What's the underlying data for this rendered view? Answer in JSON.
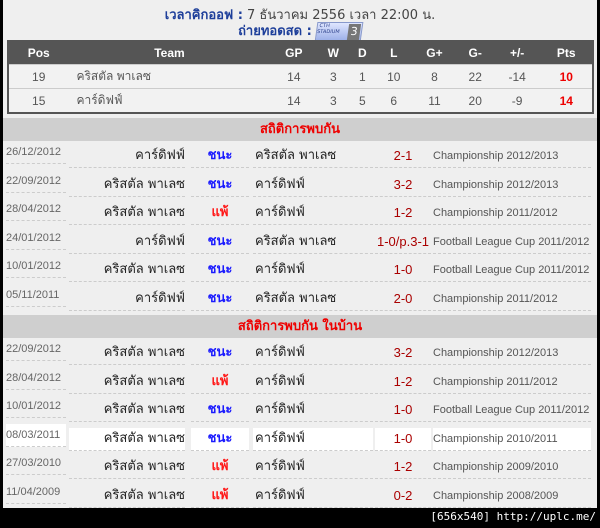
{
  "header": {
    "kickoff_label": "เวลาคิกออฟ :",
    "kickoff_value": "7 ธันวาคม 2556 เวลา 22:00 น.",
    "live_label": "ถ่ายทอดสด :",
    "channel_logo": "CTH STADIUM 3"
  },
  "standings": {
    "columns": [
      "Pos",
      "Team",
      "GP",
      "W",
      "D",
      "L",
      "G+",
      "G-",
      "+/-",
      "Pts"
    ],
    "rows": [
      [
        "19",
        "คริสตัล พาเลซ",
        "14",
        "3",
        "1",
        "10",
        "8",
        "22",
        "-14",
        "10"
      ],
      [
        "15",
        "คาร์ดิฟฟ์",
        "14",
        "3",
        "5",
        "6",
        "11",
        "20",
        "-9",
        "14"
      ]
    ]
  },
  "sections": [
    {
      "title": "สถิติการพบกัน",
      "rows": [
        {
          "date": "26/12/2012",
          "home": "คาร์ดิฟฟ์",
          "result": "ชนะ",
          "away": "คริสตัล พาเลซ",
          "score": "2-1",
          "comp": "Championship 2012/2013"
        },
        {
          "date": "22/09/2012",
          "home": "คริสตัล พาเลซ",
          "result": "ชนะ",
          "away": "คาร์ดิฟฟ์",
          "score": "3-2",
          "comp": "Championship 2012/2013"
        },
        {
          "date": "28/04/2012",
          "home": "คริสตัล พาเลซ",
          "result": "แพ้",
          "away": "คาร์ดิฟฟ์",
          "score": "1-2",
          "comp": "Championship 2011/2012"
        },
        {
          "date": "24/01/2012",
          "home": "คาร์ดิฟฟ์",
          "result": "ชนะ",
          "away": "คริสตัล พาเลซ",
          "score": "1-0/p.3-1",
          "comp": "Football League Cup 2011/2012"
        },
        {
          "date": "10/01/2012",
          "home": "คริสตัล พาเลซ",
          "result": "ชนะ",
          "away": "คาร์ดิฟฟ์",
          "score": "1-0",
          "comp": "Football League Cup 2011/2012"
        },
        {
          "date": "05/11/2011",
          "home": "คาร์ดิฟฟ์",
          "result": "ชนะ",
          "away": "คริสตัล พาเลซ",
          "score": "2-0",
          "comp": "Championship 2011/2012"
        }
      ]
    },
    {
      "title": "สถิติการพบกัน ในบ้าน",
      "rows": [
        {
          "date": "22/09/2012",
          "home": "คริสตัล พาเลซ",
          "result": "ชนะ",
          "away": "คาร์ดิฟฟ์",
          "score": "3-2",
          "comp": "Championship 2012/2013"
        },
        {
          "date": "28/04/2012",
          "home": "คริสตัล พาเลซ",
          "result": "แพ้",
          "away": "คาร์ดิฟฟ์",
          "score": "1-2",
          "comp": "Championship 2011/2012"
        },
        {
          "date": "10/01/2012",
          "home": "คริสตัล พาเลซ",
          "result": "ชนะ",
          "away": "คาร์ดิฟฟ์",
          "score": "1-0",
          "comp": "Football League Cup 2011/2012"
        },
        {
          "date": "08/03/2011",
          "home": "คริสตัล พาเลซ",
          "result": "ชนะ",
          "away": "คาร์ดิฟฟ์",
          "score": "1-0",
          "comp": "Championship 2010/2011"
        },
        {
          "date": "27/03/2010",
          "home": "คริสตัล พาเลซ",
          "result": "แพ้",
          "away": "คาร์ดิฟฟ์",
          "score": "1-2",
          "comp": "Championship 2009/2010"
        },
        {
          "date": "11/04/2009",
          "home": "คริสตัล พาเลซ",
          "result": "แพ้",
          "away": "คาร์ดิฟฟ์",
          "score": "0-2",
          "comp": "Championship 2008/2009"
        }
      ]
    }
  ],
  "colors": {
    "win": "#1a1aff",
    "loss": "#ff1a1a"
  },
  "watermark": "[656x540] http://uplc.me/"
}
